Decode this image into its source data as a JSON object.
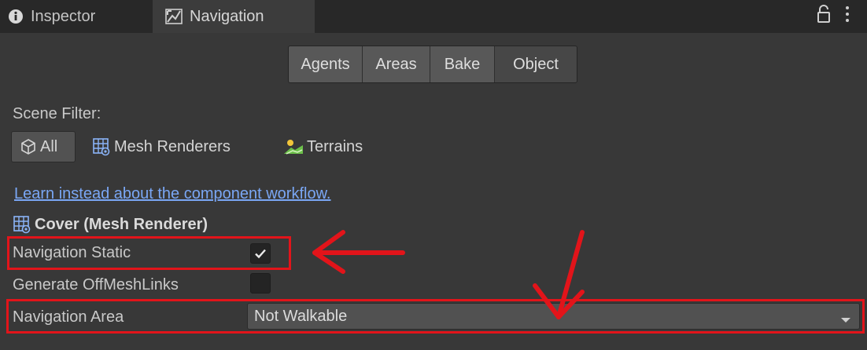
{
  "tabs": [
    {
      "label": "Inspector",
      "icon": "info-icon"
    },
    {
      "label": "Navigation",
      "icon": "navigation-icon"
    }
  ],
  "tab_actions": [
    {
      "icon": "lock-icon"
    },
    {
      "icon": "kebab-menu-icon"
    }
  ],
  "segments": [
    "Agents",
    "Areas",
    "Bake",
    "Object"
  ],
  "selected_segment": "Object",
  "scene_filter": {
    "label": "Scene Filter:",
    "options": [
      {
        "label": "All",
        "icon": "cube-icon"
      },
      {
        "label": "Mesh Renderers",
        "icon": "mesh-renderer-icon"
      },
      {
        "label": "Terrains",
        "icon": "terrain-icon"
      }
    ],
    "selected": "All"
  },
  "workflow_link": "Learn instead about the component workflow.",
  "component": {
    "title": "Cover (Mesh Renderer)",
    "icon": "mesh-renderer-icon"
  },
  "fields": {
    "navigation_static": {
      "label": "Navigation Static",
      "checked": true
    },
    "generate_offmeshlinks": {
      "label": "Generate OffMeshLinks",
      "checked": false
    },
    "navigation_area": {
      "label": "Navigation Area",
      "value": "Not Walkable"
    }
  },
  "colors": {
    "background": "#383838",
    "tabbar": "#282828",
    "link": "#7aa7f5",
    "annotation": "#e2141a"
  }
}
